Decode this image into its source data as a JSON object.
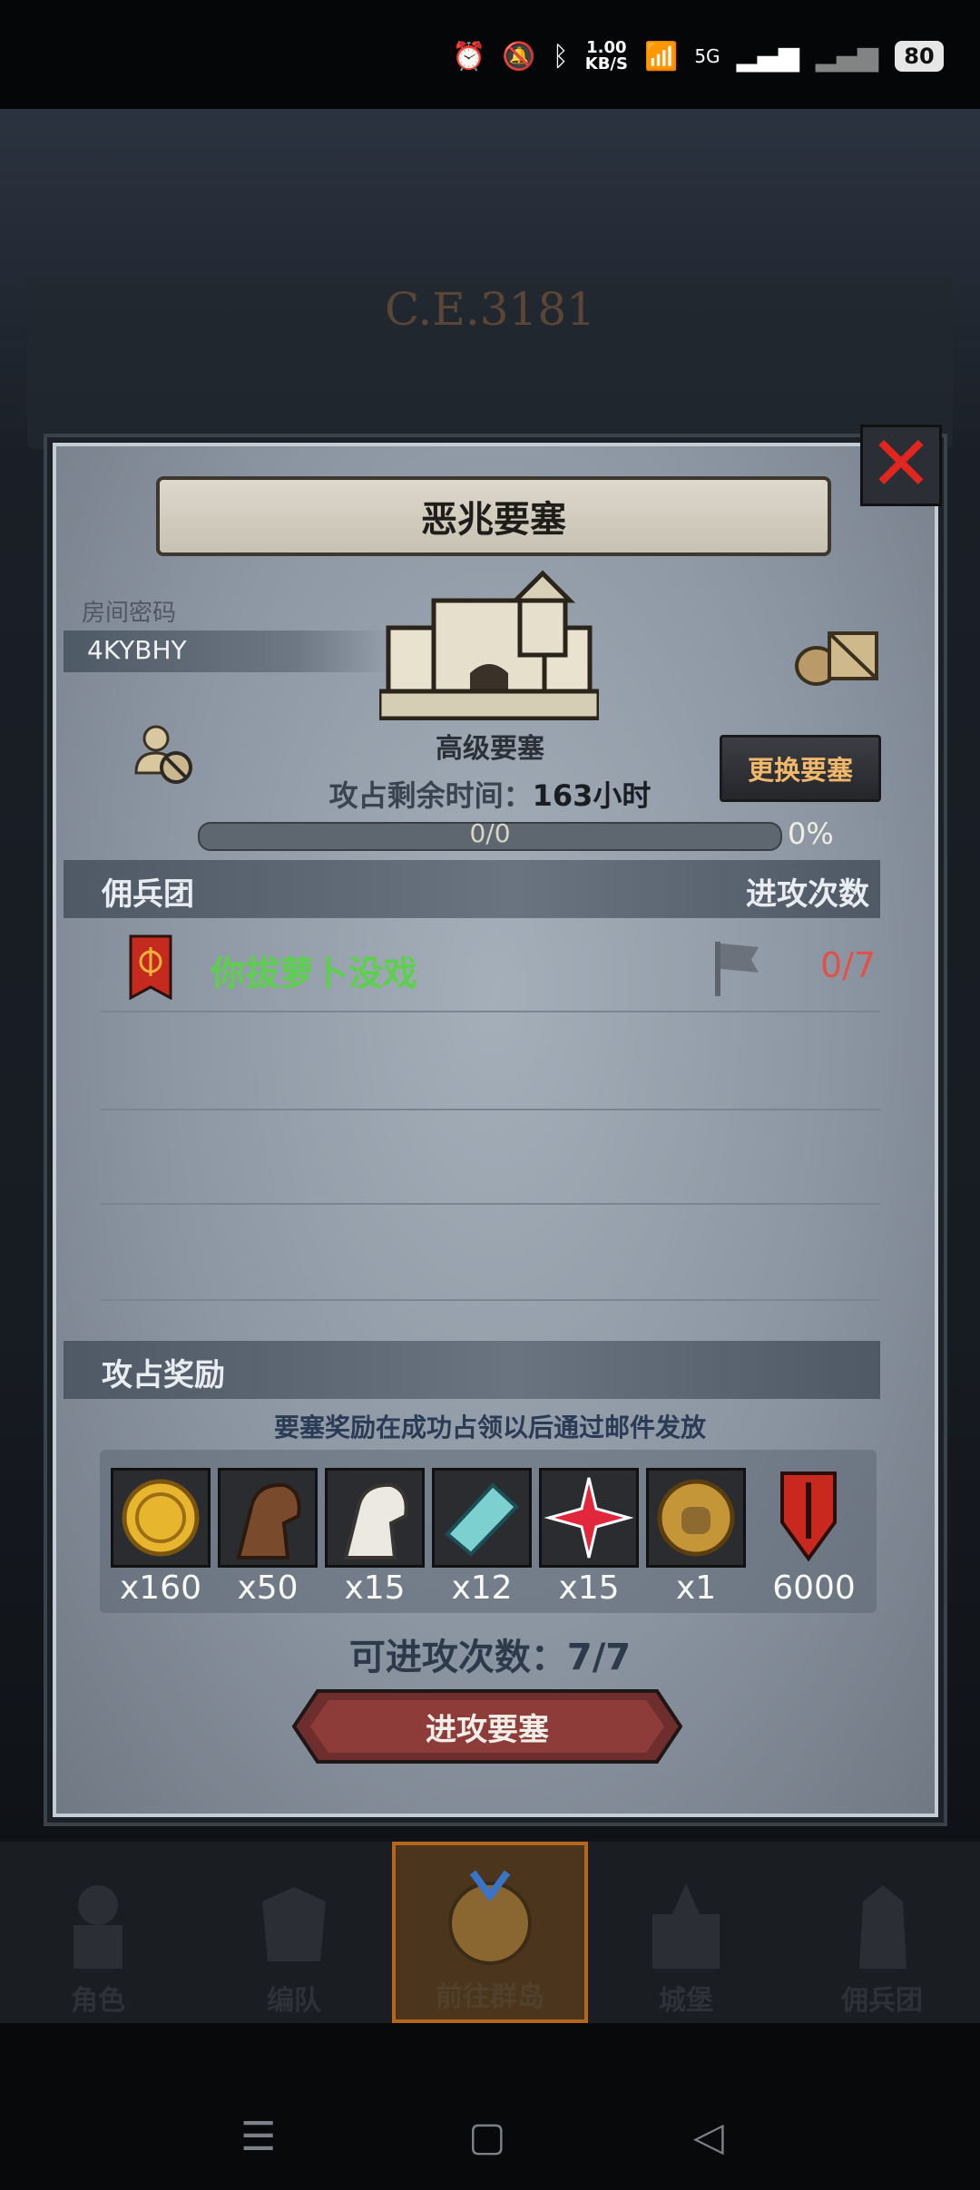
{
  "status_bar": {
    "net_speed_value": "1.00",
    "net_speed_unit": "KB/S",
    "network": "5G",
    "battery": "80"
  },
  "background": {
    "year": "C.E.3181"
  },
  "dialog": {
    "title": "恶兆要塞",
    "room_code_label": "房间密码",
    "room_code": "4KYBHY",
    "fortress_level": "高级要塞",
    "change_button": "更换要塞",
    "remaining_label": "攻占剩余时间：",
    "remaining_value": "163",
    "remaining_unit": "小时",
    "progress_text": "0/0",
    "progress_percent": "0%",
    "progress_fraction": 0,
    "mercenary_header": "佣兵团",
    "attack_count_header": "进攻次数",
    "mercenaries": [
      {
        "name": "你拔萝卜没戏",
        "attacks": "0/7"
      }
    ],
    "reward_header": "攻占奖励",
    "reward_hint": "要塞奖励在成功占领以后通过邮件发放",
    "rewards": [
      {
        "icon": "gold-coin-icon",
        "qty": "x160"
      },
      {
        "icon": "brown-horse-icon",
        "qty": "x50"
      },
      {
        "icon": "white-horse-icon",
        "qty": "x15"
      },
      {
        "icon": "cloth-roll-icon",
        "qty": "x12"
      },
      {
        "icon": "red-star-icon",
        "qty": "x15"
      },
      {
        "icon": "helmet-coin-icon",
        "qty": "x1"
      },
      {
        "icon": "red-shield-sword-icon",
        "qty": "6000"
      }
    ],
    "attempts_label": "可进攻次数：",
    "attempts_value": "7/7",
    "attack_button": "进攻要塞"
  },
  "nav": [
    {
      "label": "角色",
      "active": false
    },
    {
      "label": "编队",
      "active": false
    },
    {
      "label": "前往群岛",
      "active": true
    },
    {
      "label": "城堡",
      "active": false
    },
    {
      "label": "佣兵团",
      "active": false
    }
  ],
  "colors": {
    "accent_green": "#5cd04d",
    "count_red": "#e25148",
    "button_gold": "#f0b86a"
  }
}
